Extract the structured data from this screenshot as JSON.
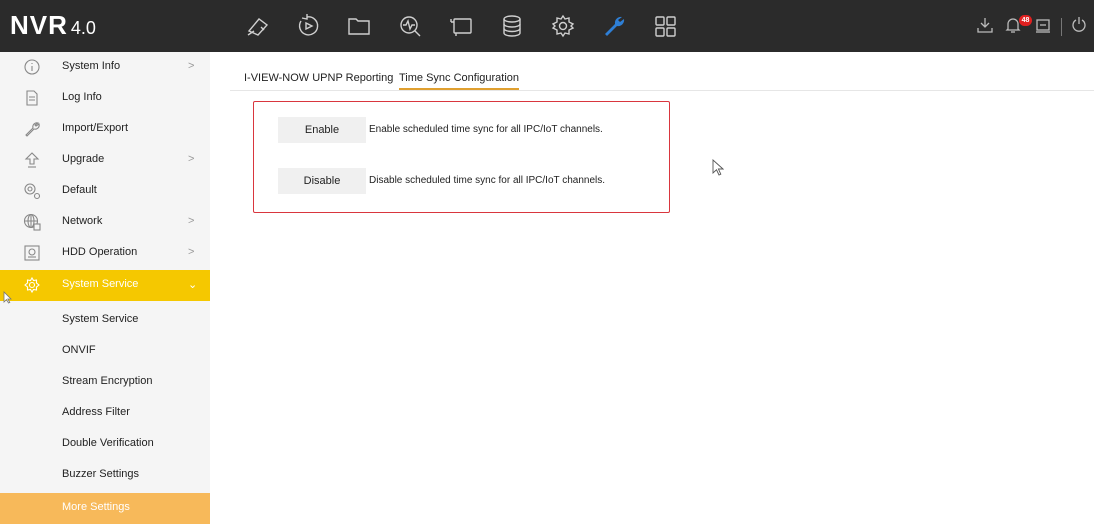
{
  "app": {
    "brand": "NVR",
    "version": "4.0",
    "alarm_count": "48"
  },
  "toolbar_icons": [
    "live-view-camera-icon",
    "playback-icon",
    "file-management-icon",
    "smart-analysis-icon",
    "camera-management-icon",
    "storage-icon",
    "configuration-gear-icon",
    "maintenance-wrench-icon",
    "more-apps-grid-icon"
  ],
  "right_icons": [
    "download-icon",
    "alarm-bell-icon",
    "lock-screen-icon",
    "power-icon"
  ],
  "colors": {
    "topbar": "#2b2b2b",
    "active_menu": "#f5c800",
    "selected_submenu": "#f7b95a",
    "panel_border": "#d9363e",
    "accent_wrench": "#2e7fd6"
  },
  "sidebar": {
    "items": [
      {
        "label": "System Info",
        "icon": "info-icon",
        "has_submenu": true
      },
      {
        "label": "Log Info",
        "icon": "log-document-icon",
        "has_submenu": false
      },
      {
        "label": "Import/Export",
        "icon": "wrench-icon",
        "has_submenu": false
      },
      {
        "label": "Upgrade",
        "icon": "upgrade-arrow-icon",
        "has_submenu": true
      },
      {
        "label": "Default",
        "icon": "default-gear-icon",
        "has_submenu": false
      },
      {
        "label": "Network",
        "icon": "network-globe-icon",
        "has_submenu": true
      },
      {
        "label": "HDD Operation",
        "icon": "hdd-icon",
        "has_submenu": true
      },
      {
        "label": "System Service",
        "icon": "system-service-icon",
        "has_submenu": true,
        "expanded": true
      }
    ],
    "subitems": [
      {
        "label": "System Service"
      },
      {
        "label": "ONVIF"
      },
      {
        "label": "Stream Encryption"
      },
      {
        "label": "Address Filter"
      },
      {
        "label": "Double Verification"
      },
      {
        "label": "Buzzer Settings"
      },
      {
        "label": "More Settings",
        "selected": true
      }
    ]
  },
  "tabs": [
    {
      "label": "I-VIEW-NOW UPNP Reporting"
    },
    {
      "label": "Time Sync Configuration",
      "active": true
    }
  ],
  "panel": {
    "enable_label": "Enable",
    "enable_desc": "Enable scheduled time sync for all IPC/IoT channels.",
    "disable_label": "Disable",
    "disable_desc": "Disable scheduled time sync for all IPC/IoT channels."
  }
}
